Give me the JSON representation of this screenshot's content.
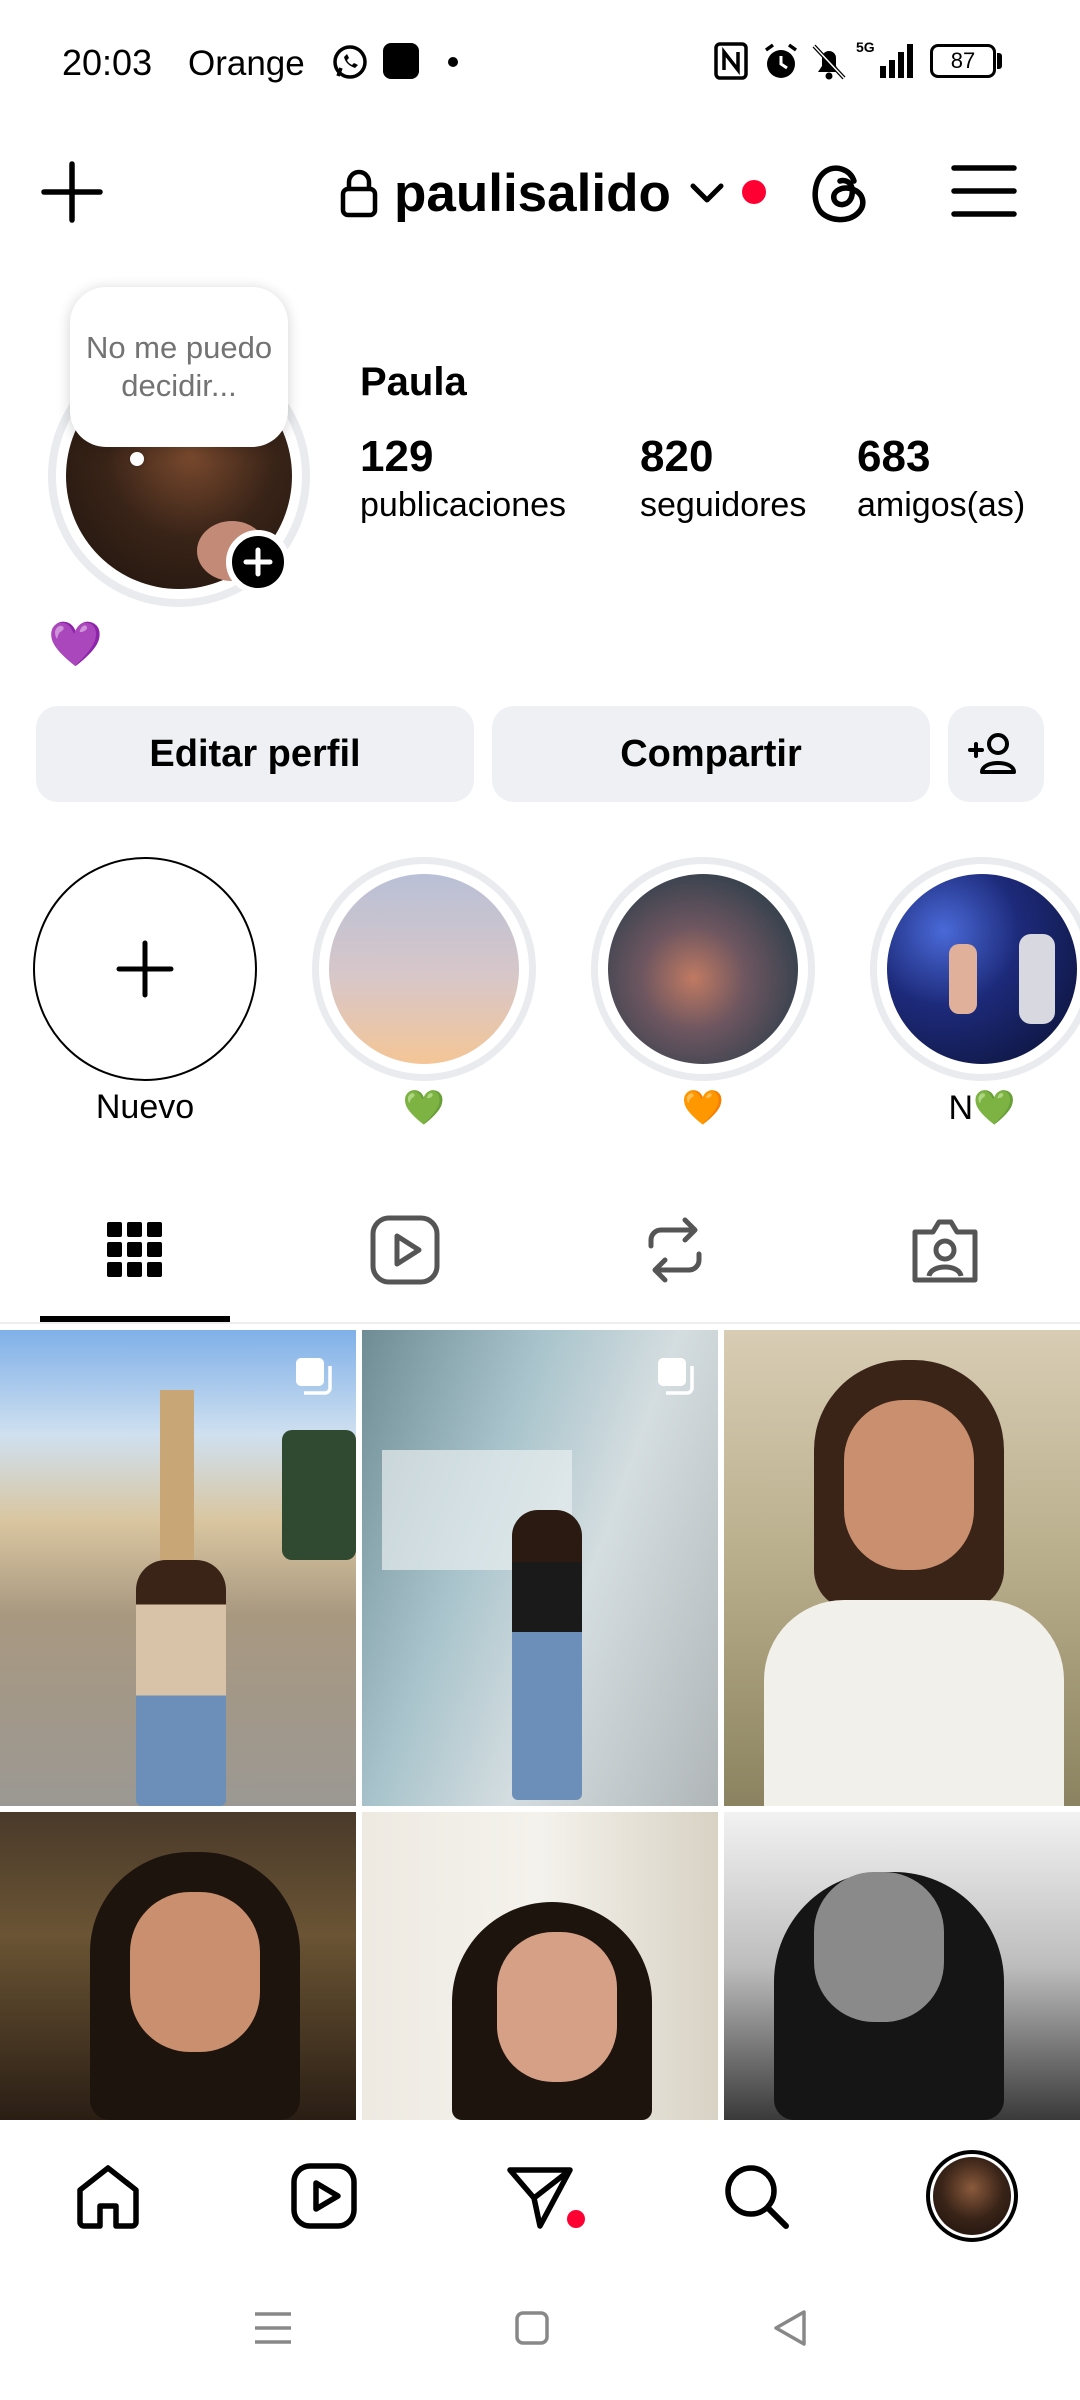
{
  "status_bar": {
    "time": "20:03",
    "carrier": "Orange",
    "battery": "87",
    "network": "5G"
  },
  "header": {
    "username": "paulisalido",
    "icons": [
      "plus-icon",
      "lock-icon",
      "chevron-down-icon",
      "threads-icon",
      "menu-icon"
    ]
  },
  "profile": {
    "note": "No me puedo decidir...",
    "display_name": "Paula",
    "bio_emoji": "💜",
    "stats": [
      {
        "value": "129",
        "label": "publicaciones"
      },
      {
        "value": "820",
        "label": "seguidores"
      },
      {
        "value": "683",
        "label": "amigos(as)"
      }
    ]
  },
  "actions": {
    "edit_profile": "Editar perfil",
    "share": "Compartir"
  },
  "highlights": [
    {
      "label": "Nuevo"
    },
    {
      "label": "💚"
    },
    {
      "label": "🧡"
    },
    {
      "label": "N💚"
    }
  ],
  "tabs": [
    "grid-icon",
    "reels-icon",
    "reposts-icon",
    "tagged-icon"
  ],
  "posts": [
    {
      "subject": "street-photo",
      "multi": true
    },
    {
      "subject": "storefront-photo",
      "multi": true
    },
    {
      "subject": "smiling-portrait",
      "multi": false
    },
    {
      "subject": "night-portrait",
      "multi": false
    },
    {
      "subject": "bathroom-portrait",
      "multi": false
    },
    {
      "subject": "bw-portrait",
      "multi": false
    }
  ],
  "bottom_nav": [
    "home-icon",
    "reels-icon",
    "send-icon",
    "search-icon",
    "profile-avatar"
  ],
  "colors": {
    "accent_red": "#ff0033",
    "button_bg": "#eef0f3",
    "ring_gray": "#e9ebee",
    "emoji_purple": "#a259e8"
  }
}
